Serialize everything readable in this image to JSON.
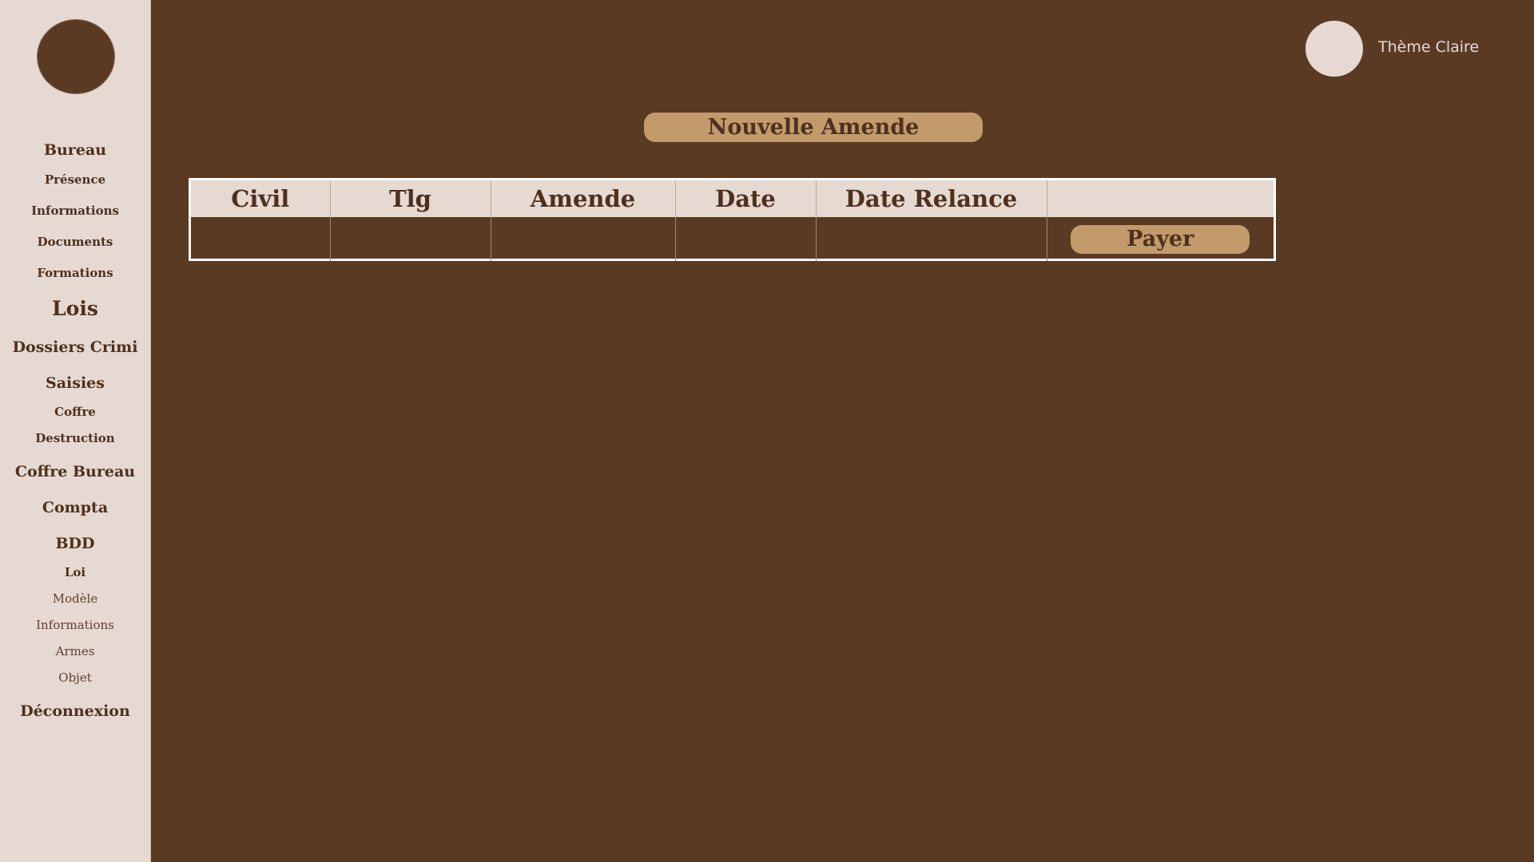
{
  "sidebar": {
    "items": [
      {
        "label": "Bureau"
      },
      {
        "label": "Présence"
      },
      {
        "label": "Informations"
      },
      {
        "label": "Documents"
      },
      {
        "label": "Formations"
      },
      {
        "label": "Lois"
      },
      {
        "label": "Dossiers Crimi"
      },
      {
        "label": "Saisies"
      },
      {
        "label": "Coffre"
      },
      {
        "label": "Destruction"
      },
      {
        "label": "Coffre Bureau"
      },
      {
        "label": "Compta"
      },
      {
        "label": "BDD"
      },
      {
        "label": "Loi"
      },
      {
        "label": "Modèle"
      },
      {
        "label": "Informations"
      },
      {
        "label": "Armes"
      },
      {
        "label": "Objet"
      },
      {
        "label": "Déconnexion"
      }
    ]
  },
  "header": {
    "theme_label": "Thème Claire"
  },
  "main": {
    "new_fine_label": "Nouvelle Amende",
    "table": {
      "columns": [
        "Civil",
        "Tlg",
        "Amende",
        "Date",
        "Date Relance",
        ""
      ],
      "rows": [
        {
          "civil": "",
          "tlg": "",
          "amende": "",
          "date": "",
          "date_relance": "",
          "action_label": "Payer"
        }
      ]
    }
  },
  "colors": {
    "background": "#5b3a24",
    "sidebar": "#e6d9d2",
    "accent": "#c29a6b",
    "text_dark": "#4e301d"
  }
}
